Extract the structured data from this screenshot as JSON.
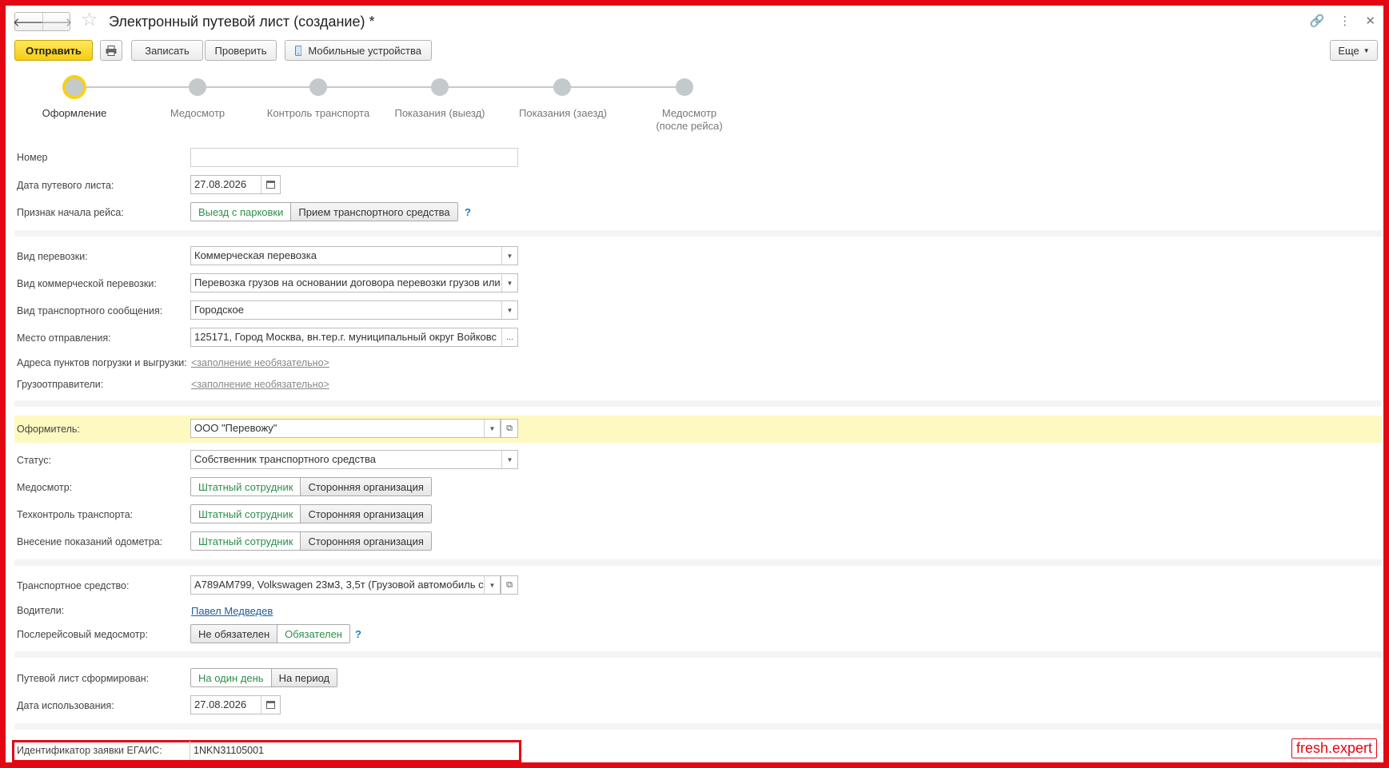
{
  "header": {
    "title": "Электронный путевой лист (создание) *",
    "back_icon": "arrow-left-icon",
    "forward_icon": "arrow-right-icon",
    "star_icon": "star-icon"
  },
  "toolbar": {
    "send": "Отправить",
    "save": "Записать",
    "check": "Проверить",
    "mobile": "Мобильные устройства",
    "more": "Еще"
  },
  "steps": [
    {
      "label": "Оформление",
      "active": true
    },
    {
      "label": "Медосмотр"
    },
    {
      "label": "Контроль транспорта"
    },
    {
      "label": "Показания (выезд)"
    },
    {
      "label": "Показания (заезд)"
    },
    {
      "label": "Медосмотр (после рейса)",
      "line1": "Медосмотр",
      "line2": "(после рейса)"
    }
  ],
  "form": {
    "number": {
      "label": "Номер",
      "value": ""
    },
    "date": {
      "label": "Дата путевого листа:",
      "value": "27.08.2026"
    },
    "trip_start": {
      "label": "Признак начала рейса:",
      "opt1": "Выезд с парковки",
      "opt2": "Прием транспортного средства",
      "help": "?"
    },
    "transport_kind": {
      "label": "Вид перевозки:",
      "value": "Коммерческая перевозка"
    },
    "commercial_kind": {
      "label": "Вид коммерческой перевозки:",
      "value": "Перевозка грузов на основании договора перевозки грузов или"
    },
    "connection_kind": {
      "label": "Вид транспортного сообщения:",
      "value": "Городское"
    },
    "departure": {
      "label": "Место отправления:",
      "value": "125171, Город Москва, вн.тер.г. муниципальный округ Войковс",
      "ellipsis": "..."
    },
    "addresses": {
      "label": "Адреса пунктов погрузки и выгрузки:",
      "value": "<заполнение необязательно>"
    },
    "shippers": {
      "label": "Грузоотправители:",
      "value": "<заполнение необязательно>"
    },
    "issuer": {
      "label": "Оформитель:",
      "value": "ООО \"Перевожу\""
    },
    "status": {
      "label": "Статус:",
      "value": "Собственник транспортного средства"
    },
    "medical": {
      "label": "Медосмотр:",
      "opt1": "Штатный сотрудник",
      "opt2": "Сторонняя организация"
    },
    "techcontrol": {
      "label": "Техконтроль транспорта:",
      "opt1": "Штатный сотрудник",
      "opt2": "Сторонняя организация"
    },
    "odometer": {
      "label": "Внесение показаний одометра:",
      "opt1": "Штатный сотрудник",
      "opt2": "Сторонняя организация"
    },
    "vehicle": {
      "label": "Транспортное средство:",
      "value": "А789АМ799, Volkswagen  23м3, 3,5т (Грузовой автомобиль с"
    },
    "drivers": {
      "label": "Водители:",
      "value": "Павел Медведев"
    },
    "post_medical": {
      "label": "Послерейсовый медосмотр:",
      "opt1": "Не обязателен",
      "opt2": "Обязателен",
      "help": "?"
    },
    "formed": {
      "label": "Путевой лист сформирован:",
      "opt1": "На один день",
      "opt2": "На период"
    },
    "use_date": {
      "label": "Дата использования:",
      "value": "27.08.2026"
    },
    "egais": {
      "label": "Идентификатор заявки ЕГАИС:",
      "value": "1NKN31105001"
    }
  },
  "watermark": "fresh.expert",
  "colors": {
    "accent_yellow": "#f5cc13",
    "frame_red": "#e30613",
    "toggle_green": "#2c8f49",
    "highlight_row": "#fef9c0"
  }
}
